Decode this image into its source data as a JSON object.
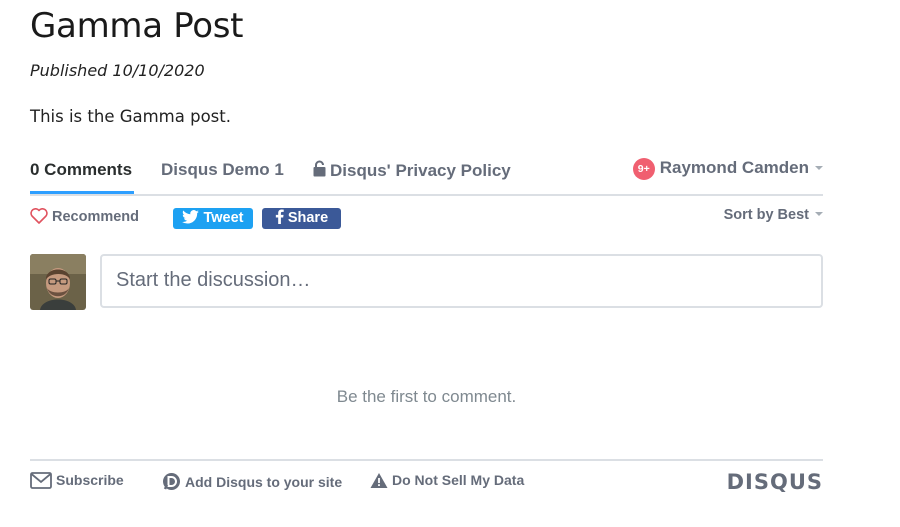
{
  "post": {
    "title": "Gamma Post",
    "published": "Published 10/10/2020",
    "body": "This is the Gamma post."
  },
  "disqus": {
    "tabs": [
      {
        "label": "0 Comments",
        "active": true
      },
      {
        "label": "Disqus Demo 1",
        "active": false
      },
      {
        "label": "Disqus' Privacy Policy",
        "active": false
      }
    ],
    "user": {
      "badge": "9+",
      "name": "Raymond Camden"
    },
    "toolbar": {
      "recommend_label": "Recommend",
      "tweet_label": "Tweet",
      "share_label": "Share",
      "sort_label": "Sort by Best"
    },
    "composer": {
      "placeholder": "Start the discussion…"
    },
    "empty_message": "Be the first to comment.",
    "footer": {
      "subscribe_label": "Subscribe",
      "add_disqus_label": "Add Disqus to your site",
      "do_not_sell_label": "Do Not Sell My Data",
      "logo_text": "DISQUS"
    },
    "colors": {
      "accent": "#2e9fff",
      "tweet": "#1da1f2",
      "facebook": "#3b5998",
      "badge": "#f05f70",
      "heart": "#e0535f",
      "text_muted": "#656c7a"
    },
    "icons": [
      "lock-icon",
      "heart-icon",
      "twitter-icon",
      "facebook-icon",
      "envelope-icon",
      "disqus-d-icon",
      "warning-icon"
    ]
  }
}
